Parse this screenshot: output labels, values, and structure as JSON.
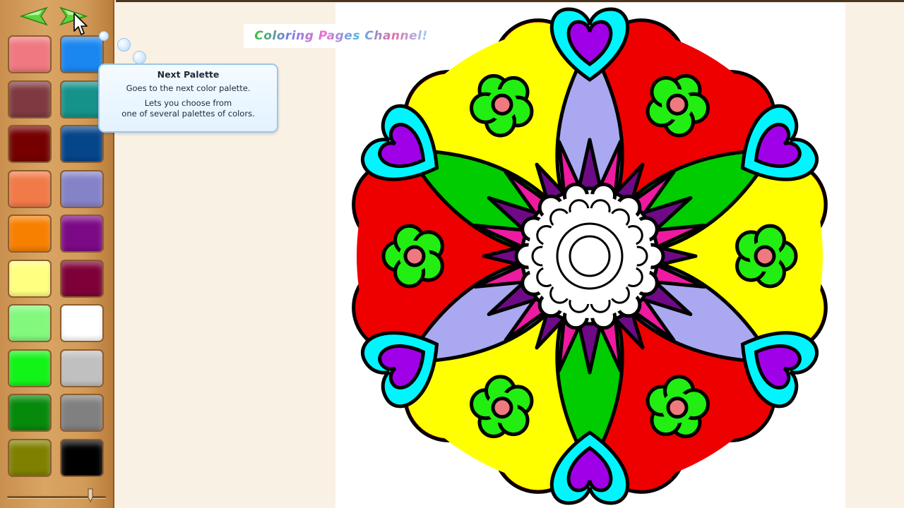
{
  "app": {
    "brand_text": "Coloring Pages Channel!"
  },
  "toolbar": {
    "prev_icon": "left-arrow-icon",
    "next_icon": "right-arrow-icon"
  },
  "tooltip": {
    "title": "Next Palette",
    "line1": "Goes to the next color palette.",
    "line2": "Lets you choose from",
    "line3": "one of several palettes of colors."
  },
  "palette": {
    "swatches": [
      {
        "name": "swatch-salmon",
        "color": "#f07880"
      },
      {
        "name": "swatch-blue",
        "color": "#1a86f0"
      },
      {
        "name": "swatch-maroon",
        "color": "#7e3a40"
      },
      {
        "name": "swatch-teal",
        "color": "#15928a"
      },
      {
        "name": "swatch-dark-red",
        "color": "#760000"
      },
      {
        "name": "swatch-navy",
        "color": "#05458a"
      },
      {
        "name": "swatch-coral",
        "color": "#f27a48"
      },
      {
        "name": "swatch-periwinkle",
        "color": "#8583c8"
      },
      {
        "name": "swatch-orange",
        "color": "#f78000"
      },
      {
        "name": "swatch-purple",
        "color": "#7c0a86"
      },
      {
        "name": "swatch-pale-yellow",
        "color": "#ffff80"
      },
      {
        "name": "swatch-burgundy",
        "color": "#7d0038"
      },
      {
        "name": "swatch-light-green",
        "color": "#82f97c"
      },
      {
        "name": "swatch-white",
        "color": "#ffffff"
      },
      {
        "name": "swatch-green",
        "color": "#12f318"
      },
      {
        "name": "swatch-light-gray",
        "color": "#c0c0c0"
      },
      {
        "name": "swatch-dark-green",
        "color": "#068a0c"
      },
      {
        "name": "swatch-gray",
        "color": "#808080"
      },
      {
        "name": "swatch-olive",
        "color": "#7f8000"
      },
      {
        "name": "swatch-black",
        "color": "#000000"
      }
    ]
  },
  "mandala_colors": {
    "red": "#ee0000",
    "yellow": "#ffff00",
    "cyan": "#00f5ff",
    "violet": "#a000e8",
    "green": "#00cc00",
    "lime": "#22ee11",
    "pink": "#ee7a80",
    "lavender": "#aaa8f0",
    "magenta": "#ee1aa0",
    "deep_purple": "#6e0a86",
    "white": "#ffffff",
    "outline": "#000000"
  }
}
